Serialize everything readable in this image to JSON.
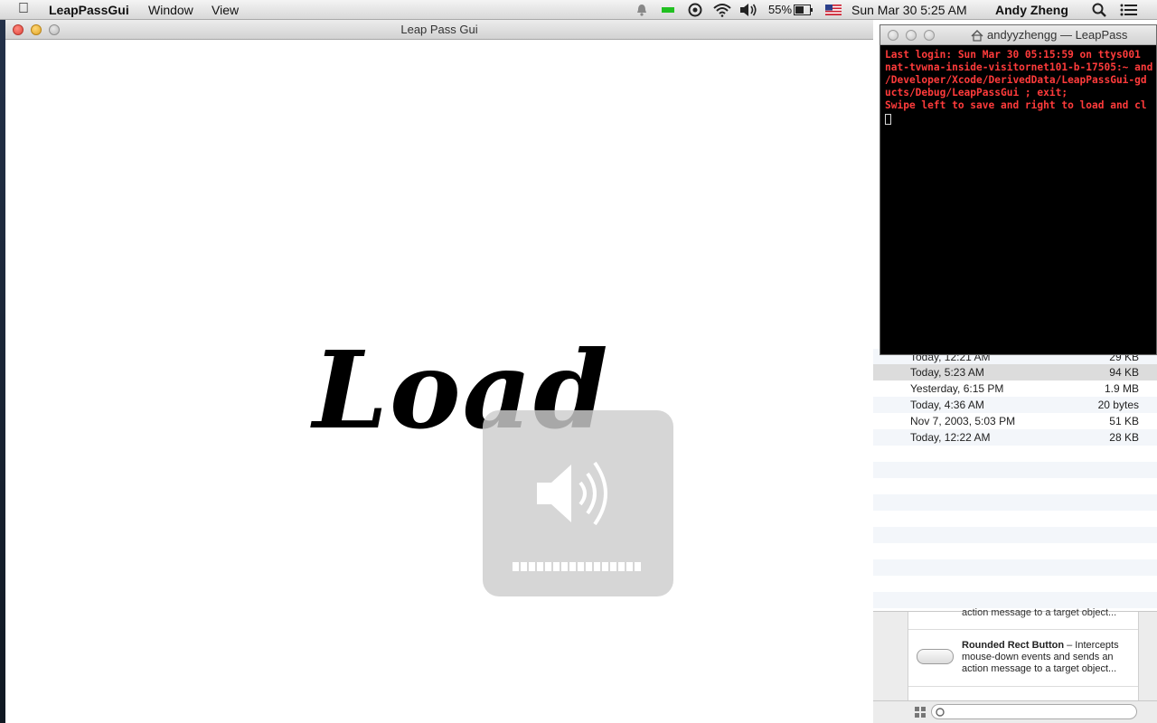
{
  "menubar": {
    "app_name": "LeapPassGui",
    "menus": [
      "Window",
      "View"
    ],
    "battery": "55%",
    "clock": "Sun Mar 30  5:25 AM",
    "user": "Andy Zheng"
  },
  "main_window": {
    "title": "Leap Pass Gui",
    "content_text": "Load"
  },
  "volume_hud": {
    "level": 1.0,
    "segments": 16
  },
  "terminal": {
    "title": "andyyzhengg — LeapPass",
    "lines": [
      "Last login: Sun Mar 30 05:15:59 on ttys001",
      "nat-tvwna-inside-visitornet101-b-17505:~ and",
      "/Developer/Xcode/DerivedData/LeapPassGui-gd",
      "ucts/Debug/LeapPassGui ; exit;",
      "Swipe left to save and right to load and cl"
    ]
  },
  "file_list": {
    "rows": [
      {
        "date": "Today, 12:21 AM",
        "size": "29 KB"
      },
      {
        "date": "Today, 5:23 AM",
        "size": "94 KB"
      },
      {
        "date": "Yesterday, 6:15 PM",
        "size": "1.9 MB"
      },
      {
        "date": "Today, 4:36 AM",
        "size": "20 bytes"
      },
      {
        "date": "Nov 7, 2003, 5:03 PM",
        "size": "51 KB"
      },
      {
        "date": "Today, 12:22 AM",
        "size": "28 KB"
      }
    ]
  },
  "object_library": {
    "prev_desc_tail": "action message to a target object...",
    "item_title": "Rounded Rect Button",
    "item_desc_1": " – Intercepts",
    "item_desc_2": "mouse-down events and sends an",
    "item_desc_3": "action message to a target object..."
  }
}
